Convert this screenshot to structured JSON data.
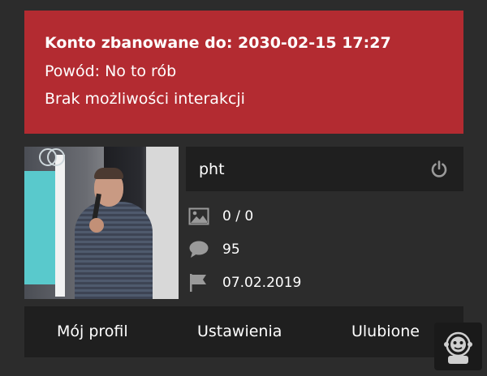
{
  "ban": {
    "title": "Konto zbanowane do: 2030-02-15 17:27",
    "reason": "Powód: No to rób",
    "note": "Brak możliwości interakcji"
  },
  "profile": {
    "username": "pht",
    "stats": [
      {
        "icon": "image-icon",
        "value": "0 / 0"
      },
      {
        "icon": "comment-icon",
        "value": "95"
      },
      {
        "icon": "flag-icon",
        "value": "07.02.2019"
      }
    ]
  },
  "tabs": [
    {
      "label": "Mój profil"
    },
    {
      "label": "Ustawienia"
    },
    {
      "label": "Ulubione"
    }
  ],
  "colors": {
    "ban_bg": "#b32b31",
    "panel_bg": "#2c2c2c",
    "bar_bg": "#1f1f1f",
    "text": "#ffffff",
    "icon": "#9a9a9a"
  }
}
